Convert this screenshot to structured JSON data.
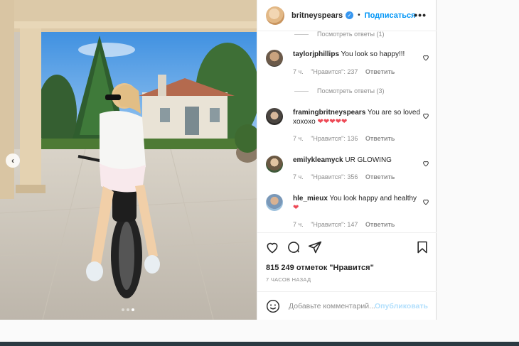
{
  "post": {
    "username": "britneyspears",
    "follow_label": "Подписаться",
    "dot": "•",
    "more_label": "•••",
    "carousel": {
      "slide_count": 3,
      "active_slide": 3,
      "prev_label": "‹"
    }
  },
  "comments": [
    {
      "view_replies_before": "Посмотреть ответы (1)"
    },
    {
      "username": "taylorjphillips",
      "text": "You look so happy!!!",
      "time": "7 ч.",
      "likes": "\"Нравится\": 237",
      "reply": "Ответить",
      "view_replies": "Посмотреть ответы (3)"
    },
    {
      "username": "framingbritneyspears",
      "text": "You are so loved xoxoxo",
      "hearts": "❤❤❤❤❤",
      "time": "7 ч.",
      "likes": "\"Нравится\": 136",
      "reply": "Ответить"
    },
    {
      "username": "emilykleamyck",
      "text": "UR GLOWING",
      "time": "7 ч.",
      "likes": "\"Нравится\": 356",
      "reply": "Ответить"
    },
    {
      "username": "hle_mieux",
      "text": "You look happy and healthy",
      "hearts": "❤",
      "time": "7 ч.",
      "likes": "\"Нравится\": 147",
      "reply": "Ответить"
    }
  ],
  "stats": {
    "likes": "815 249 отметок \"Нравится\"",
    "time_ago": "7 ЧАСОВ НАЗАД"
  },
  "add_comment": {
    "placeholder": "Добавьте комментарий...",
    "publish": "Опубликовать"
  },
  "icons": {
    "like": "heart-icon",
    "comment": "comment-icon",
    "share": "share-icon",
    "save": "bookmark-icon",
    "emoji": "emoji-icon",
    "verified": "verified-icon"
  },
  "colors": {
    "accent": "#0095f6",
    "publish_disabled": "#b2dffc",
    "heart": "#ed4956",
    "muted": "#8e8e8e"
  }
}
